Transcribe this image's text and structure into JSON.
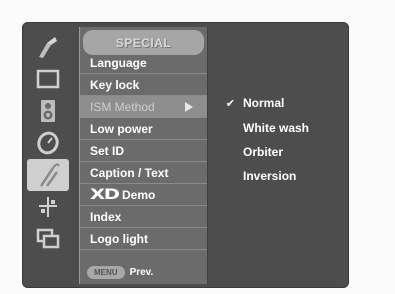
{
  "menu": {
    "title": "SPECIAL",
    "items": [
      {
        "label": "Language",
        "selected": false
      },
      {
        "label": "Key lock",
        "selected": false
      },
      {
        "label": "ISM Method",
        "selected": true
      },
      {
        "label": "Low power",
        "selected": false
      },
      {
        "label": "Set ID",
        "selected": false
      },
      {
        "label": "Caption / Text",
        "selected": false
      },
      {
        "logo": "XD",
        "label": "Demo",
        "selected": false
      },
      {
        "label": "Index",
        "selected": false
      },
      {
        "label": "Logo light",
        "selected": false
      }
    ],
    "footer": {
      "key_label": "MENU",
      "action_label": "Prev."
    }
  },
  "submenu": {
    "options": [
      {
        "label": "Normal",
        "checked": true,
        "check_mark": "✔"
      },
      {
        "label": "White wash",
        "checked": false,
        "check_mark": ""
      },
      {
        "label": "Orbiter",
        "checked": false,
        "check_mark": ""
      },
      {
        "label": "Inversion",
        "checked": false,
        "check_mark": ""
      }
    ]
  },
  "icons": [
    {
      "name": "station-icon",
      "active": false
    },
    {
      "name": "picture-icon",
      "active": false
    },
    {
      "name": "sound-icon",
      "active": false
    },
    {
      "name": "time-icon",
      "active": false
    },
    {
      "name": "special-icon",
      "active": true
    },
    {
      "name": "setup-icon",
      "active": false
    },
    {
      "name": "pip-icon",
      "active": false
    }
  ],
  "colors": {
    "osd_background": "#4d4d4d",
    "menu_panel": "#6b6b6b",
    "selected_row": "#8e8e8e",
    "title_bar": "#a6a6a6",
    "text": "#ffffff"
  }
}
